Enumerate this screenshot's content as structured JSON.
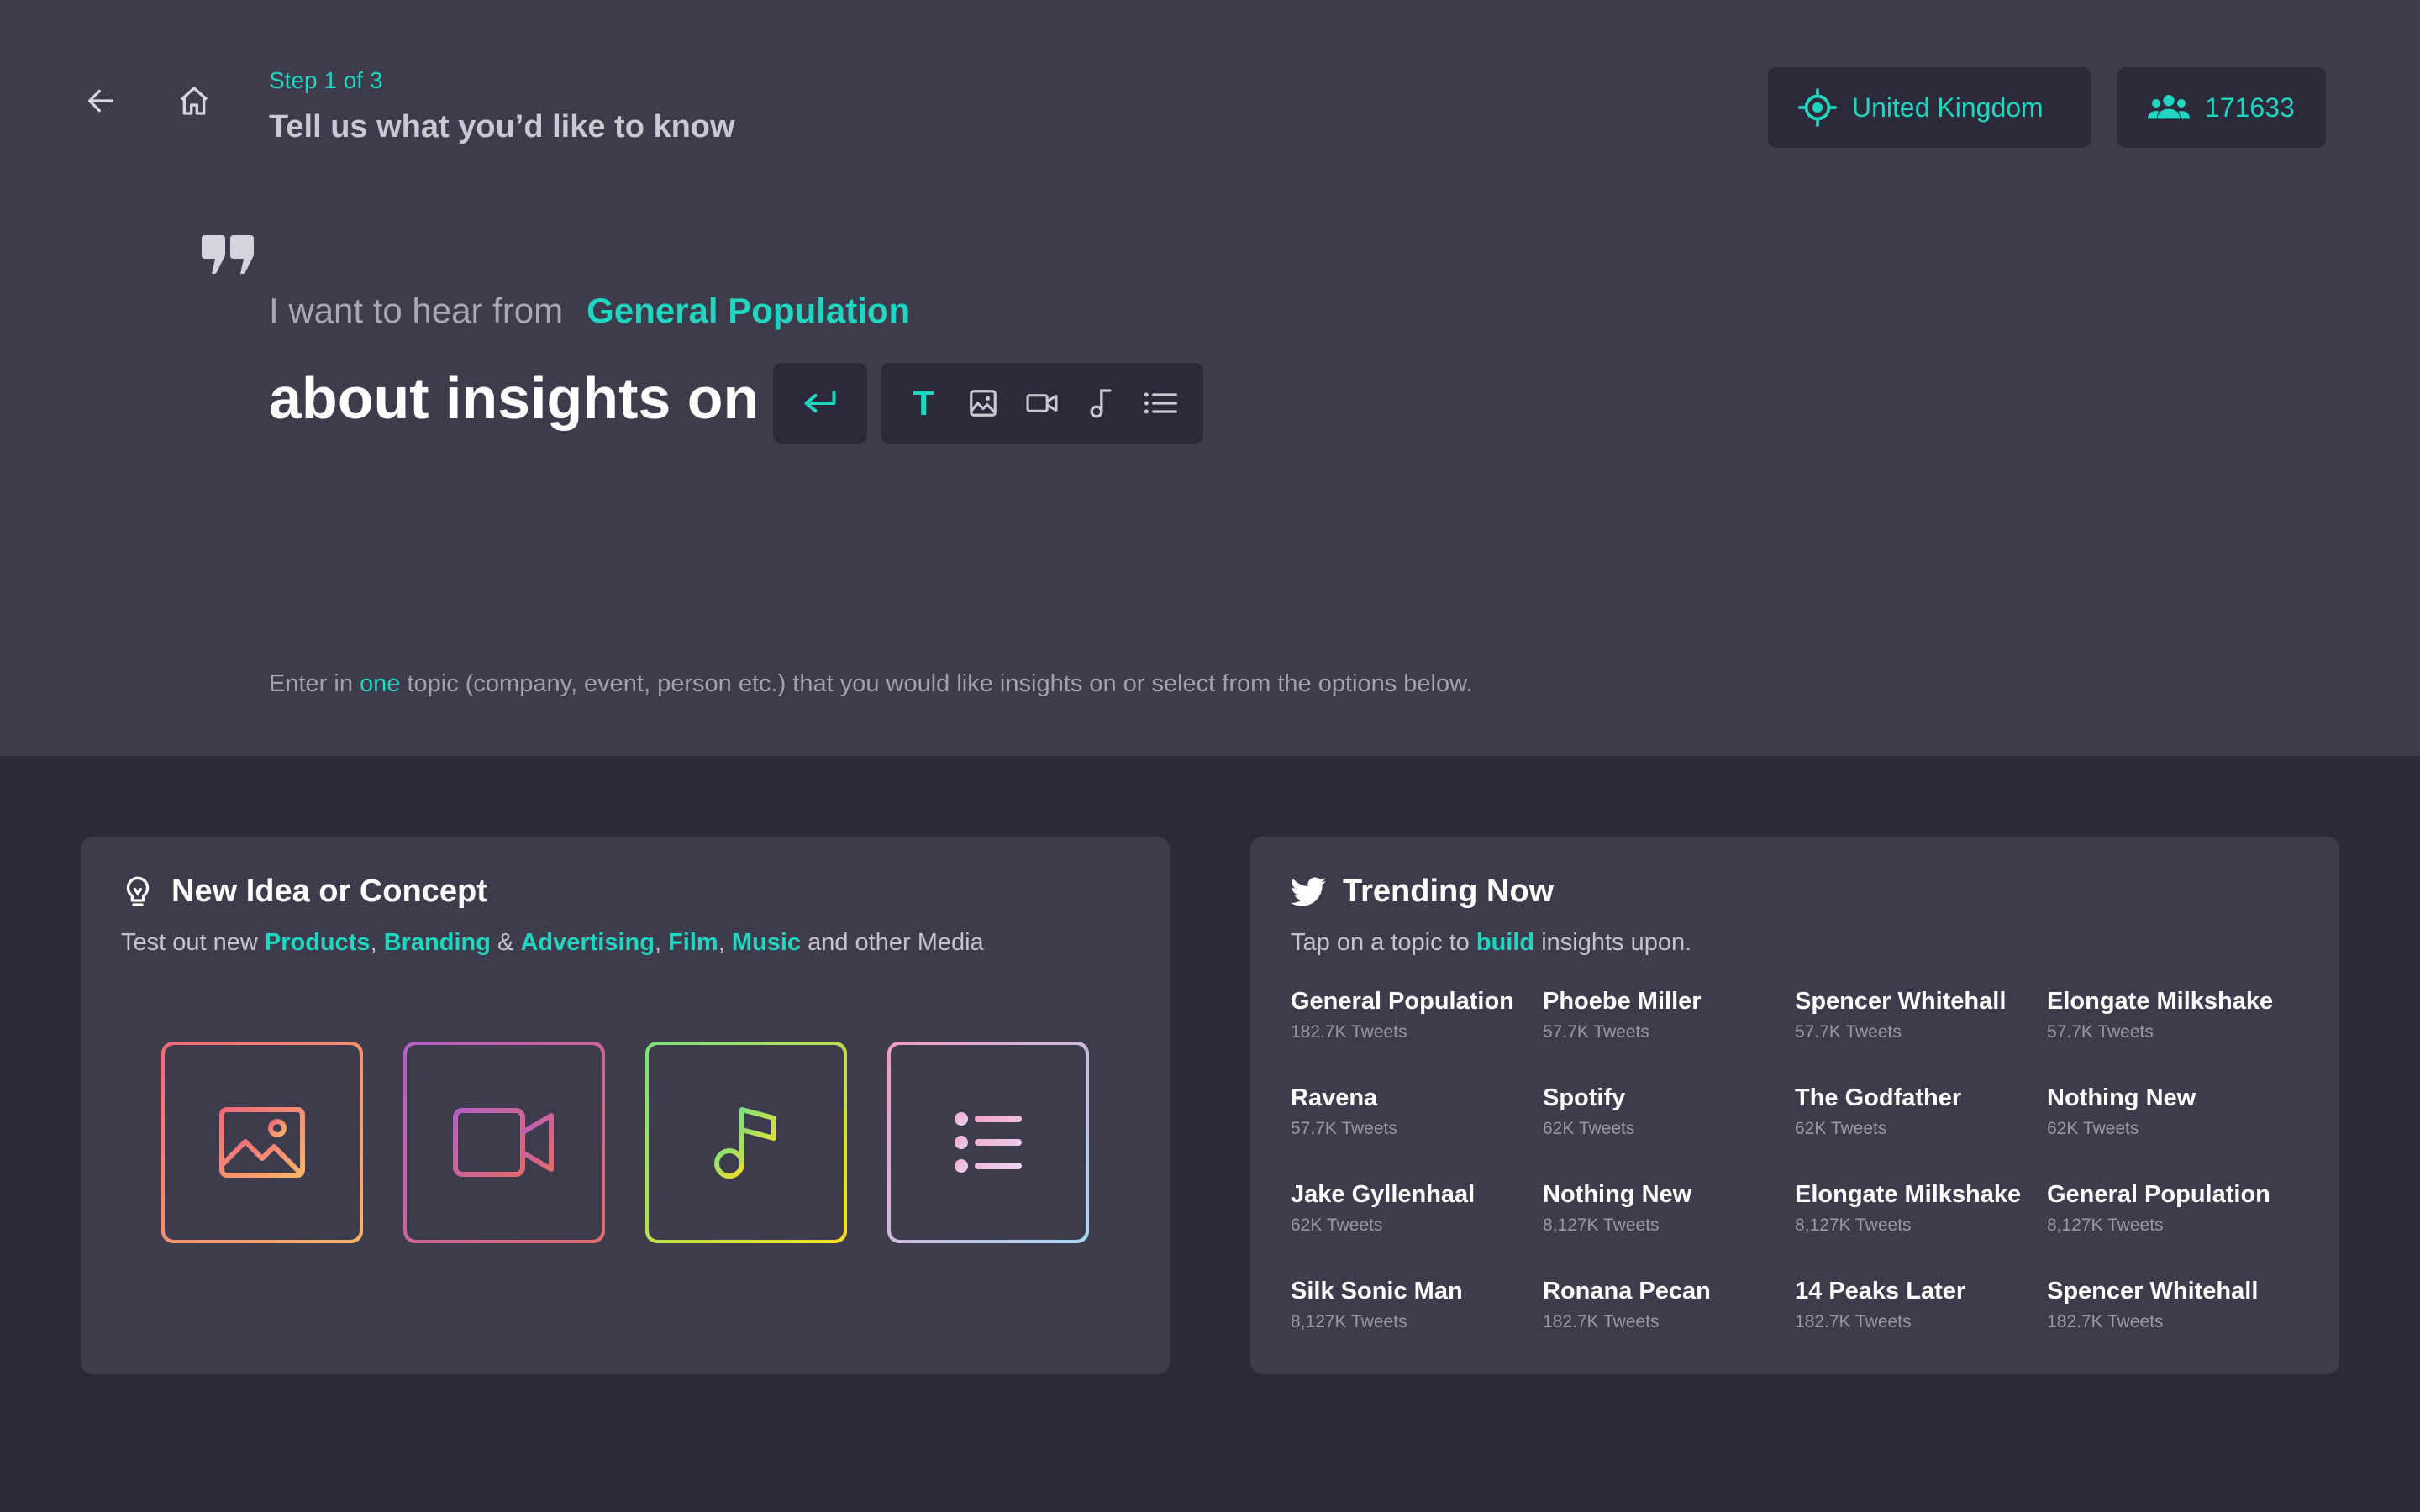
{
  "header": {
    "step": "Step 1 of 3",
    "title": "Tell us what you’d like to know",
    "country": "United Kingdom",
    "audience_count": "171633"
  },
  "prompt": {
    "hear_prefix": "I want to hear from",
    "population": "General Population",
    "about": "about insights on"
  },
  "toolbar": {
    "text_tool": "T",
    "icons": [
      "enter-icon",
      "text-icon",
      "image-icon",
      "video-icon",
      "music-icon",
      "list-icon"
    ]
  },
  "hint": {
    "part1": "Enter in ",
    "highlight": "one",
    "part2": " topic (company, event, person etc.) that you would like insights on or select from the options below."
  },
  "idea_card": {
    "title": "New Idea or Concept",
    "sub_prefix": "Test out new ",
    "products": "Products",
    "sep1": ", ",
    "branding": "Branding",
    "amp": " & ",
    "advertising": "Advertising",
    "sep2": ", ",
    "film": "Film",
    "sep3": ", ",
    "music": "Music",
    "sub_suffix": " and other Media",
    "tiles": [
      "image-icon",
      "video-icon",
      "music-icon",
      "list-icon"
    ]
  },
  "trending": {
    "title": "Trending Now",
    "sub_prefix": "Tap on a topic to ",
    "sub_highlight": "build",
    "sub_suffix": " insights upon.",
    "items": [
      {
        "name": "General Population",
        "count": "182.7K Tweets"
      },
      {
        "name": "Phoebe Miller",
        "count": "57.7K Tweets"
      },
      {
        "name": "Spencer Whitehall",
        "count": "57.7K Tweets"
      },
      {
        "name": "Elongate Milkshake",
        "count": "57.7K Tweets"
      },
      {
        "name": "Ravena",
        "count": "57.7K Tweets"
      },
      {
        "name": "Spotify",
        "count": "62K Tweets"
      },
      {
        "name": "The Godfather",
        "count": "62K Tweets"
      },
      {
        "name": "Nothing New",
        "count": "62K Tweets"
      },
      {
        "name": "Jake Gyllenhaal",
        "count": "62K Tweets"
      },
      {
        "name": "Nothing New",
        "count": "8,127K Tweets"
      },
      {
        "name": "Elongate Milkshake",
        "count": "8,127K Tweets"
      },
      {
        "name": "General Population",
        "count": "8,127K Tweets"
      },
      {
        "name": "Silk Sonic Man",
        "count": "8,127K Tweets"
      },
      {
        "name": "Ronana Pecan",
        "count": "182.7K Tweets"
      },
      {
        "name": "14 Peaks Later",
        "count": "182.7K Tweets"
      },
      {
        "name": "Spencer Whitehall",
        "count": "182.7K Tweets"
      }
    ]
  },
  "colors": {
    "accent": "#20d6c0",
    "top_bg": "#3c3c4d",
    "page_bg": "#2a2a3a"
  }
}
